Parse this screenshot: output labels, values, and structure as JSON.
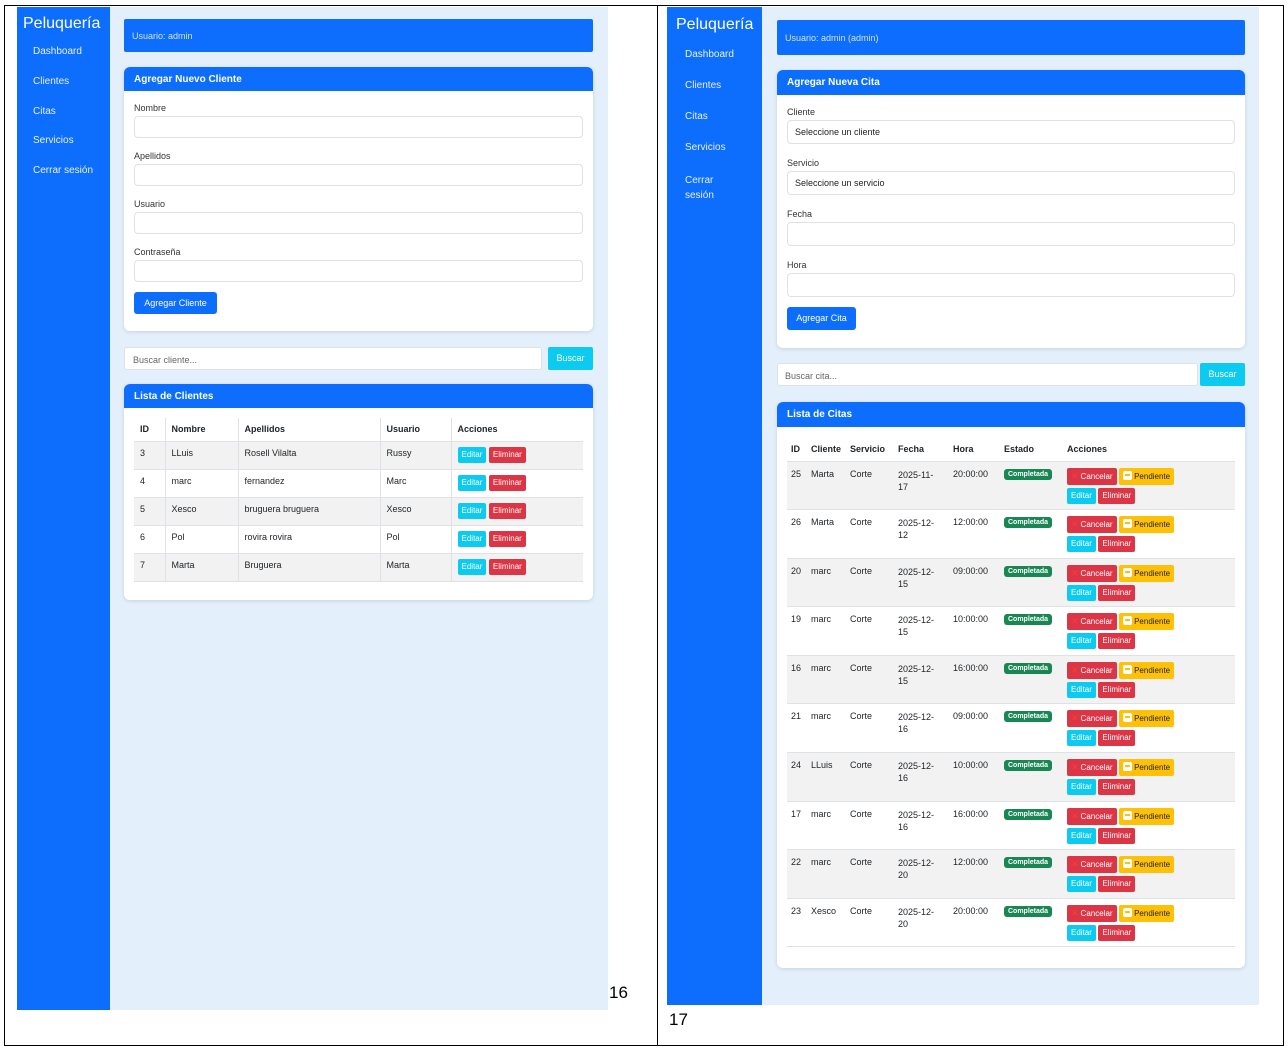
{
  "left": {
    "brand": "Peluquería",
    "nav": [
      "Dashboard",
      "Clientes",
      "Citas",
      "Servicios",
      "Cerrar sesión"
    ],
    "user_bar": "Usuario: admin",
    "form": {
      "title": "Agregar Nuevo Cliente",
      "fields": [
        "Nombre",
        "Apellidos",
        "Usuario",
        "Contraseña"
      ],
      "submit": "Agregar Cliente"
    },
    "search": {
      "placeholder": "Buscar cliente...",
      "button": "Buscar"
    },
    "list": {
      "title": "Lista de Clientes",
      "headers": [
        "ID",
        "Nombre",
        "Apellidos",
        "Usuario",
        "Acciones"
      ],
      "rows": [
        {
          "id": "3",
          "nombre": "LLuis",
          "apellidos": "Rosell Vilalta",
          "usuario": "Russy"
        },
        {
          "id": "4",
          "nombre": "marc",
          "apellidos": "fernandez",
          "usuario": "Marc"
        },
        {
          "id": "5",
          "nombre": "Xesco",
          "apellidos": "bruguera bruguera",
          "usuario": "Xesco"
        },
        {
          "id": "6",
          "nombre": "Pol",
          "apellidos": "rovira rovira",
          "usuario": "Pol"
        },
        {
          "id": "7",
          "nombre": "Marta",
          "apellidos": "Bruguera",
          "usuario": "Marta"
        }
      ],
      "edit_label": "Editar",
      "delete_label": "Eliminar"
    },
    "page_number": "16"
  },
  "right": {
    "brand": "Peluquería",
    "nav": [
      "Dashboard",
      "Clientes",
      "Citas",
      "Servicios",
      "Cerrar sesión"
    ],
    "user_bar": "Usuario: admin (admin)",
    "form": {
      "title": "Agregar Nueva Cita",
      "cliente_label": "Cliente",
      "cliente_value": "Seleccione un cliente",
      "servicio_label": "Servicio",
      "servicio_value": "Seleccione un servicio",
      "fecha_label": "Fecha",
      "hora_label": "Hora",
      "submit": "Agregar Cita"
    },
    "search": {
      "placeholder": "Buscar cita...",
      "button": "Buscar"
    },
    "list": {
      "title": "Lista de Citas",
      "headers": [
        "ID",
        "Cliente",
        "Servicio",
        "Fecha",
        "Hora",
        "Estado",
        "Acciones"
      ],
      "rows": [
        {
          "id": "25",
          "cliente": "Marta",
          "servicio": "Corte",
          "fecha1": "2025-11-",
          "fecha2": "17",
          "hora": "20:00:00",
          "estado": "Completada"
        },
        {
          "id": "26",
          "cliente": "Marta",
          "servicio": "Corte",
          "fecha1": "2025-12-",
          "fecha2": "12",
          "hora": "12:00:00",
          "estado": "Completada"
        },
        {
          "id": "20",
          "cliente": "marc",
          "servicio": "Corte",
          "fecha1": "2025-12-",
          "fecha2": "15",
          "hora": "09:00:00",
          "estado": "Completada"
        },
        {
          "id": "19",
          "cliente": "marc",
          "servicio": "Corte",
          "fecha1": "2025-12-",
          "fecha2": "15",
          "hora": "10:00:00",
          "estado": "Completada"
        },
        {
          "id": "16",
          "cliente": "marc",
          "servicio": "Corte",
          "fecha1": "2025-12-",
          "fecha2": "15",
          "hora": "16:00:00",
          "estado": "Completada"
        },
        {
          "id": "21",
          "cliente": "marc",
          "servicio": "Corte",
          "fecha1": "2025-12-",
          "fecha2": "16",
          "hora": "09:00:00",
          "estado": "Completada"
        },
        {
          "id": "24",
          "cliente": "LLuis",
          "servicio": "Corte",
          "fecha1": "2025-12-",
          "fecha2": "16",
          "hora": "10:00:00",
          "estado": "Completada"
        },
        {
          "id": "17",
          "cliente": "marc",
          "servicio": "Corte",
          "fecha1": "2025-12-",
          "fecha2": "16",
          "hora": "16:00:00",
          "estado": "Completada"
        },
        {
          "id": "22",
          "cliente": "marc",
          "servicio": "Corte",
          "fecha1": "2025-12-",
          "fecha2": "20",
          "hora": "12:00:00",
          "estado": "Completada"
        },
        {
          "id": "23",
          "cliente": "Xesco",
          "servicio": "Corte",
          "fecha1": "2025-12-",
          "fecha2": "20",
          "hora": "20:00:00",
          "estado": "Completada"
        }
      ],
      "cancel_label": "Cancelar",
      "pending_label": "Pendiente",
      "edit_label": "Editar",
      "delete_label": "Eliminar"
    },
    "page_number": "17"
  },
  "colors": {
    "primary": "#0d6efd",
    "info": "#0dcaf0",
    "danger": "#dc3545",
    "warning": "#ffc107",
    "success": "#198754",
    "page_bg": "#e3effb"
  }
}
